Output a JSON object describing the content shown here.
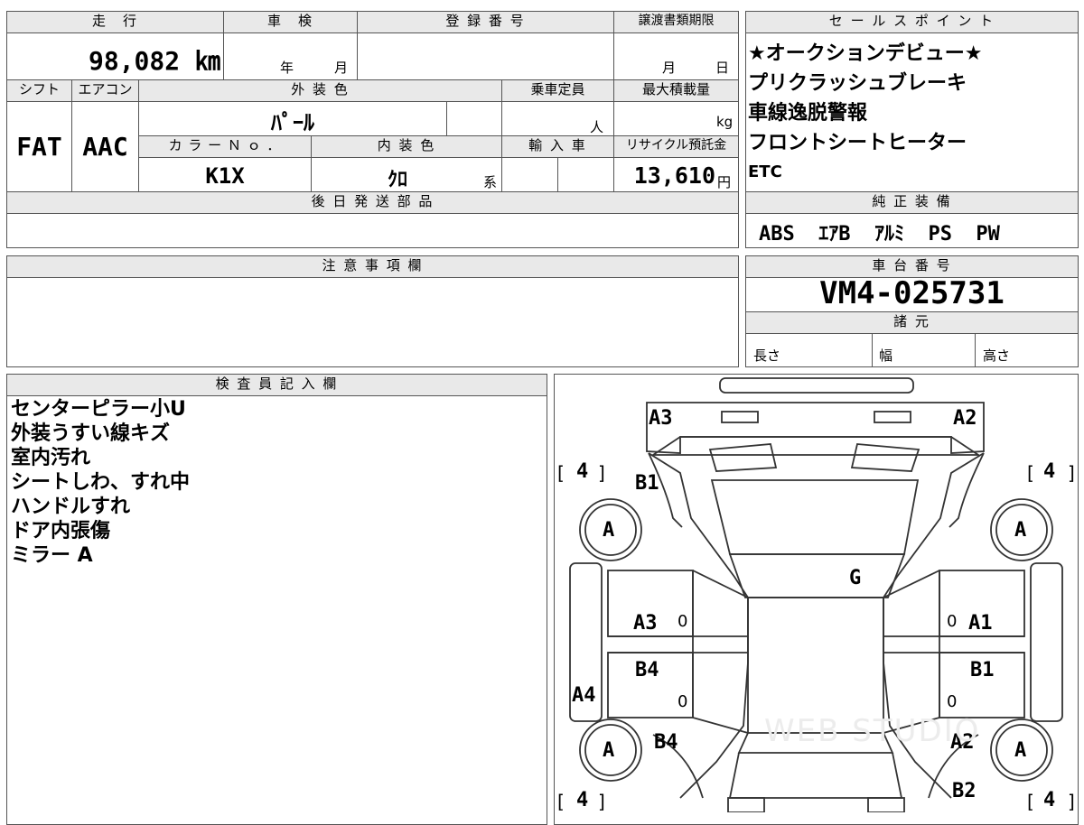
{
  "top": {
    "headers": {
      "mileage": "走　行",
      "inspection": "車　検",
      "registration": "登 録 番 号",
      "transfer_deadline": "譲渡書類期限",
      "shift": "シフト",
      "aircon": "エアコン",
      "exterior_color": "外 装 色",
      "capacity": "乗車定員",
      "max_load": "最大積載量",
      "color_no": "カ ラ ー Ｎ ｏ ．",
      "interior_color": "内 装 色",
      "import": "輸 入 車",
      "recycle_fee": "リサイクル預託金",
      "later_parts": "後 日 発 送 部 品"
    },
    "values": {
      "mileage": "98,082 ㎞",
      "year_unit": "年",
      "month_unit": "月",
      "deadline_month": "月",
      "deadline_day": "日",
      "shift": "FAT",
      "aircon": "AAC",
      "exterior_color": "ﾊﾟｰﾙ",
      "capacity_unit": "人",
      "load_unit": "kg",
      "color_no": "K1X",
      "interior_color": "ｸﾛ",
      "interior_suffix": "系",
      "recycle_fee": "13,610",
      "yen": "円"
    }
  },
  "sales": {
    "header": "セ ー ル ス ポ イ ン ト",
    "points": [
      "★オークションデビュー★",
      "プリクラッシュブレーキ",
      "車線逸脱警報",
      "フロントシートヒーター",
      "ETC"
    ]
  },
  "equipment": {
    "header": "純 正 装 備",
    "value": "ABS  ｴｱB  ｱﾙﾐ  PS  PW"
  },
  "notes": {
    "header": "注 意 事 項 欄"
  },
  "chassis": {
    "header": "車 台 番 号",
    "value": "VM4-025731"
  },
  "specs": {
    "header": "諸 元",
    "length": "長さ",
    "width": "幅",
    "height": "高さ"
  },
  "inspector": {
    "header": "検 査 員 記 入 欄",
    "lines": [
      "センターピラー小U",
      "外装うすい線キズ",
      "室内汚れ",
      "シートしわ、すれ中",
      "ハンドルすれ",
      "ドア内張傷",
      "ミラー A"
    ]
  },
  "diagram": {
    "tire_score": "4",
    "bracket_l": "[",
    "bracket_r": "]",
    "tire": "A",
    "zero": "0",
    "marks": {
      "rear_left": "A3",
      "rear_right": "A2",
      "quarter_left": "B1",
      "roof": "G",
      "rear_door_left": "A3",
      "rear_door_right": "A1",
      "front_door_left": "B4",
      "front_door_right": "B1",
      "sill_left": "A4",
      "fender_left": "B4",
      "fender_right": "A2",
      "front_right": "B2"
    },
    "watermark": "WEB STUDIO"
  }
}
